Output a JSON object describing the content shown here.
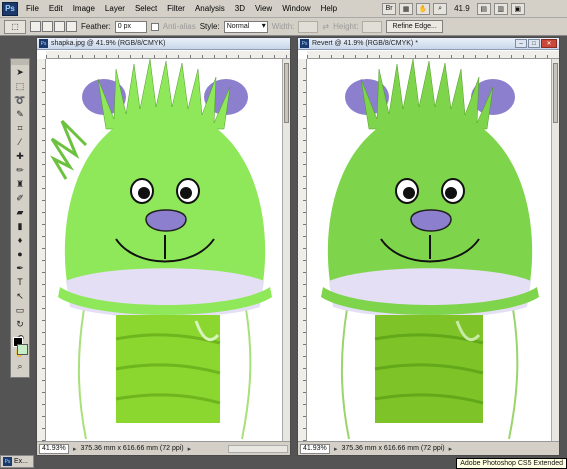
{
  "app": {
    "logo_text": "Ps",
    "menus": [
      "File",
      "Edit",
      "Image",
      "Layer",
      "Select",
      "Filter",
      "Analysis",
      "3D",
      "View",
      "Window",
      "Help"
    ],
    "zoom_level": "41.9",
    "tooltip": "Adobe Photoshop CS5 Extended"
  },
  "options_bar": {
    "feather_label": "Feather:",
    "feather_value": "0 px",
    "anti_alias_label": "Anti-alias",
    "style_label": "Style:",
    "style_value": "Normal",
    "width_label": "Width:",
    "height_label": "Height:",
    "refine_edge_label": "Refine Edge..."
  },
  "documents": [
    {
      "title": "shapka.jpg @ 41.9% (RGB/8/CMYK)",
      "zoom": "41.93%",
      "size": "375.36 mm x 616.66 mm (72 ppi)"
    },
    {
      "title": "Revert @ 41.9% (RGB/8/CMYK) *",
      "zoom": "41.93%",
      "size": "375.36 mm x 616.66 mm (72 ppi)",
      "window_buttons": [
        "minimize",
        "maximize",
        "close"
      ]
    }
  ],
  "minimized_tab": {
    "label": "Ex..."
  },
  "colors": {
    "hat_left": "#8ee85a",
    "hat_right": "#7ed44a",
    "hat_stroke": "#62b52f",
    "ear": "#8b7fce",
    "nose": "#8b7fce",
    "lining": "#e4dff5",
    "knit_left": "#8cd630",
    "knit_right": "#7ec428"
  },
  "icons": {
    "tools": [
      "move-icon",
      "marquee-icon",
      "lasso-icon",
      "quick-select-icon",
      "crop-icon",
      "eyedropper-icon",
      "healing-icon",
      "brush-icon",
      "clone-stamp-icon",
      "history-brush-icon",
      "eraser-icon",
      "gradient-icon",
      "blur-icon",
      "dodge-icon",
      "pen-icon",
      "type-icon",
      "path-select-icon",
      "shape-icon",
      "3d-rotate-icon",
      "3d-orbit-icon",
      "hand-icon",
      "zoom-icon"
    ]
  }
}
